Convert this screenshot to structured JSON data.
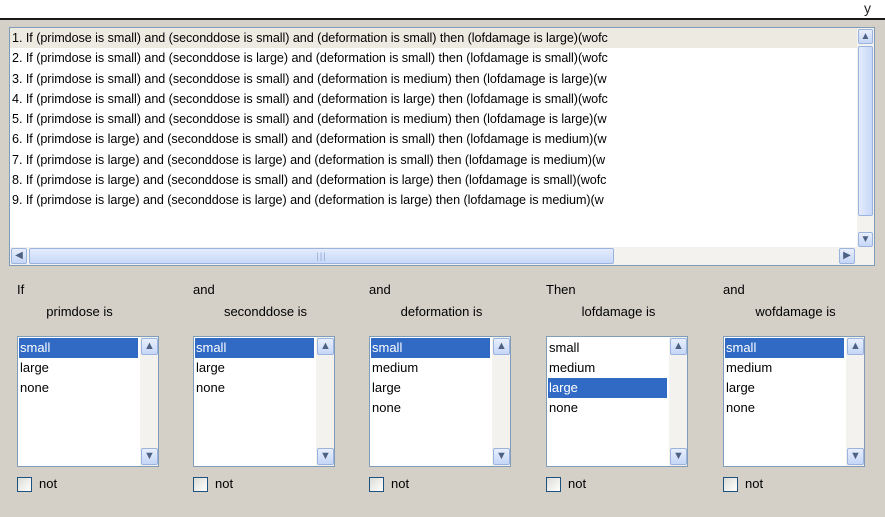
{
  "rules": [
    "1. If (primdose is small) and (seconddose is small) and (deformation is small) then (lofdamage is large)(wofc",
    "2. If (primdose is small) and (seconddose is large) and (deformation is small) then (lofdamage is small)(wofc",
    "3. If (primdose is small) and (seconddose is small) and (deformation is medium) then (lofdamage is large)(w",
    "4. If (primdose is small) and (seconddose is small) and (deformation is large) then (lofdamage is small)(wofc",
    "5. If (primdose is small) and (seconddose is small) and (deformation is medium) then (lofdamage is large)(w",
    "6. If (primdose is large) and (seconddose is small) and (deformation is small) then (lofdamage is medium)(w",
    "7. If (primdose is large) and (seconddose is large) and (deformation is small) then (lofdamage is medium)(w",
    "8. If (primdose is large) and (seconddose is small) and (deformation is large) then (lofdamage is small)(wofc",
    "9. If (primdose is large) and (seconddose is large) and (deformation is large) then (lofdamage is medium)(w"
  ],
  "selected_rule_index": 0,
  "columns": [
    {
      "connector": "If",
      "variable_label": "primdose is",
      "options": [
        "small",
        "large",
        "none"
      ],
      "selected": 0,
      "not_label": "not",
      "not_checked": false
    },
    {
      "connector": "and",
      "variable_label": "seconddose is",
      "options": [
        "small",
        "large",
        "none"
      ],
      "selected": 0,
      "not_label": "not",
      "not_checked": false
    },
    {
      "connector": "and",
      "variable_label": "deformation is",
      "options": [
        "small",
        "medium",
        "large",
        "none"
      ],
      "selected": 0,
      "not_label": "not",
      "not_checked": false
    },
    {
      "connector": "Then",
      "variable_label": "lofdamage is",
      "options": [
        "small",
        "medium",
        "large",
        "none"
      ],
      "selected": 2,
      "not_label": "not",
      "not_checked": false
    },
    {
      "connector": "and",
      "variable_label": "wofdamage is",
      "options": [
        "small",
        "medium",
        "large",
        "none"
      ],
      "selected": 0,
      "not_label": "not",
      "not_checked": false
    }
  ]
}
